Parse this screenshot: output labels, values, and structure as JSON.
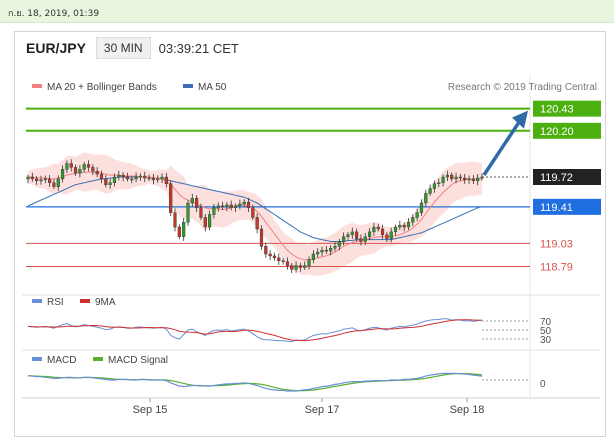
{
  "timestamp": "ก.ย. 18, 2019, 01:39",
  "header": {
    "pair": "EUR/JPY",
    "timeframe": "30 MIN",
    "time": "03:39:21 CET"
  },
  "legend": {
    "ma20": "MA 20 + Bollinger Bands",
    "ma50": "MA 50",
    "credit": "Research © 2019 Trading Central"
  },
  "colors": {
    "up": "#2e9b2e",
    "down": "#c0392b",
    "ma20": "#f08080",
    "ma50": "#3a6eb5",
    "band": "#fbd5d3",
    "resistance": "#4caf10",
    "support_blue": "#1f6fe0",
    "support_red": "#d9534f",
    "arrow": "#2f6aa8"
  },
  "levels": [
    {
      "value": "120.43",
      "kind": "resistance"
    },
    {
      "value": "120.20",
      "kind": "resistance"
    },
    {
      "value": "119.72",
      "kind": "current"
    },
    {
      "value": "119.41",
      "kind": "pivot"
    },
    {
      "value": "119.03",
      "kind": "support"
    },
    {
      "value": "118.79",
      "kind": "support"
    }
  ],
  "rsi": {
    "labels": [
      "RSI",
      "9MA"
    ],
    "ticks": [
      "70",
      "50",
      "30"
    ]
  },
  "macd": {
    "labels": [
      "MACD",
      "MACD Signal"
    ],
    "ticks": [
      "0"
    ]
  },
  "xaxis": [
    "Sep 15",
    "Sep 17",
    "Sep 18"
  ],
  "chart_data": {
    "type": "candlestick",
    "ylim": [
      118.65,
      120.52
    ],
    "close": [
      119.72,
      119.7,
      119.68,
      119.69,
      119.7,
      119.66,
      119.62,
      119.7,
      119.8,
      119.86,
      119.82,
      119.76,
      119.8,
      119.85,
      119.82,
      119.78,
      119.75,
      119.7,
      119.64,
      119.66,
      119.72,
      119.74,
      119.72,
      119.7,
      119.7,
      119.72,
      119.73,
      119.71,
      119.71,
      119.69,
      119.7,
      119.72,
      119.65,
      119.35,
      119.2,
      119.1,
      119.25,
      119.45,
      119.5,
      119.4,
      119.3,
      119.2,
      119.33,
      119.4,
      119.42,
      119.41,
      119.43,
      119.4,
      119.42,
      119.44,
      119.46,
      119.4,
      119.3,
      119.18,
      119.0,
      118.92,
      118.9,
      118.88,
      118.85,
      118.84,
      118.8,
      118.76,
      118.8,
      118.78,
      118.8,
      118.86,
      118.92,
      118.94,
      118.96,
      118.95,
      118.98,
      119.0,
      119.05,
      119.1,
      119.12,
      119.15,
      119.08,
      119.05,
      119.1,
      119.15,
      119.2,
      119.18,
      119.12,
      119.08,
      119.15,
      119.2,
      119.22,
      119.2,
      119.25,
      119.3,
      119.35,
      119.45,
      119.55,
      119.6,
      119.65,
      119.66,
      119.72,
      119.74,
      119.7,
      119.72,
      119.71,
      119.69,
      119.7,
      119.68,
      119.71,
      119.72
    ],
    "ma20": [
      119.72,
      119.72,
      119.71,
      119.71,
      119.71,
      119.7,
      119.7,
      119.71,
      119.72,
      119.74,
      119.75,
      119.76,
      119.77,
      119.77,
      119.77,
      119.77,
      119.77,
      119.76,
      119.75,
      119.74,
      119.74,
      119.74,
      119.73,
      119.73,
      119.73,
      119.73,
      119.72,
      119.72,
      119.72,
      119.71,
      119.71,
      119.7,
      119.68,
      119.64,
      119.59,
      119.54,
      119.5,
      119.48,
      119.46,
      119.44,
      119.42,
      119.4,
      119.39,
      119.39,
      119.39,
      119.38,
      119.39,
      119.4,
      119.42,
      119.43,
      119.43,
      119.42,
      119.4,
      119.36,
      119.31,
      119.25,
      119.19,
      119.13,
      119.07,
      119.01,
      118.96,
      118.92,
      118.89,
      118.87,
      118.86,
      118.86,
      118.87,
      118.88,
      118.89,
      118.9,
      118.92,
      118.94,
      118.97,
      119.0,
      119.02,
      119.04,
      119.05,
      119.06,
      119.07,
      119.08,
      119.09,
      119.1,
      119.1,
      119.1,
      119.1,
      119.11,
      119.12,
      119.14,
      119.16,
      119.19,
      119.23,
      119.28,
      119.34,
      119.4,
      119.46,
      119.51,
      119.56,
      119.6,
      119.64,
      119.67,
      119.68,
      119.69,
      119.7,
      119.7,
      119.7,
      119.7
    ],
    "ma50": [
      119.42,
      119.44,
      119.46,
      119.48,
      119.5,
      119.52,
      119.54,
      119.56,
      119.58,
      119.6,
      119.62,
      119.64,
      119.65,
      119.66,
      119.67,
      119.68,
      119.69,
      119.7,
      119.7,
      119.71,
      119.71,
      119.72,
      119.72,
      119.72,
      119.72,
      119.72,
      119.72,
      119.72,
      119.72,
      119.71,
      119.71,
      119.7,
      119.69,
      119.68,
      119.67,
      119.66,
      119.65,
      119.64,
      119.63,
      119.62,
      119.61,
      119.6,
      119.59,
      119.58,
      119.57,
      119.56,
      119.55,
      119.54,
      119.53,
      119.52,
      119.51,
      119.49,
      119.47,
      119.45,
      119.42,
      119.39,
      119.36,
      119.33,
      119.3,
      119.27,
      119.24,
      119.21,
      119.18,
      119.15,
      119.13,
      119.11,
      119.09,
      119.08,
      119.07,
      119.06,
      119.05,
      119.05,
      119.05,
      119.05,
      119.06,
      119.06,
      119.07,
      119.07,
      119.07,
      119.07,
      119.07,
      119.07,
      119.07,
      119.07,
      119.07,
      119.08,
      119.09,
      119.1,
      119.11,
      119.12,
      119.13,
      119.14,
      119.16,
      119.18,
      119.2,
      119.22,
      119.24,
      119.26,
      119.28,
      119.3,
      119.32,
      119.34,
      119.36,
      119.38,
      119.4,
      119.41
    ],
    "rsi": [
      58,
      57,
      56,
      57,
      58,
      56,
      54,
      58,
      62,
      64,
      60,
      57,
      59,
      62,
      60,
      58,
      56,
      54,
      51,
      52,
      56,
      57,
      56,
      54,
      54,
      56,
      57,
      55,
      55,
      54,
      55,
      56,
      52,
      38,
      33,
      30,
      40,
      50,
      52,
      46,
      42,
      38,
      45,
      49,
      50,
      49,
      51,
      48,
      49,
      51,
      52,
      48,
      42,
      35,
      30,
      28,
      28,
      27,
      26,
      26,
      25,
      24,
      28,
      27,
      28,
      33,
      38,
      40,
      42,
      41,
      44,
      46,
      48,
      52,
      53,
      55,
      50,
      48,
      51,
      54,
      56,
      55,
      52,
      50,
      54,
      56,
      58,
      57,
      59,
      61,
      63,
      67,
      70,
      72,
      73,
      73,
      75,
      75,
      72,
      73,
      72,
      70,
      71,
      69,
      71,
      72
    ],
    "macd": [
      0.08,
      0.07,
      0.06,
      0.06,
      0.05,
      0.04,
      0.03,
      0.03,
      0.04,
      0.05,
      0.05,
      0.04,
      0.04,
      0.05,
      0.05,
      0.04,
      0.03,
      0.02,
      0.01,
      0.0,
      0.0,
      0.01,
      0.01,
      0.01,
      0.0,
      0.0,
      0.01,
      0.01,
      0.0,
      0.0,
      0.0,
      0.0,
      -0.01,
      -0.05,
      -0.08,
      -0.11,
      -0.12,
      -0.11,
      -0.1,
      -0.1,
      -0.1,
      -0.11,
      -0.11,
      -0.1,
      -0.09,
      -0.08,
      -0.07,
      -0.07,
      -0.06,
      -0.06,
      -0.05,
      -0.06,
      -0.08,
      -0.1,
      -0.13,
      -0.15,
      -0.17,
      -0.18,
      -0.19,
      -0.19,
      -0.2,
      -0.2,
      -0.2,
      -0.19,
      -0.18,
      -0.17,
      -0.15,
      -0.14,
      -0.12,
      -0.11,
      -0.1,
      -0.08,
      -0.07,
      -0.05,
      -0.04,
      -0.03,
      -0.03,
      -0.03,
      -0.02,
      -0.02,
      -0.01,
      -0.01,
      -0.01,
      -0.01,
      0.0,
      0.0,
      0.0,
      0.01,
      0.01,
      0.02,
      0.03,
      0.05,
      0.07,
      0.09,
      0.1,
      0.11,
      0.12,
      0.12,
      0.12,
      0.12,
      0.11,
      0.11,
      0.1,
      0.09,
      0.08,
      0.07
    ]
  }
}
